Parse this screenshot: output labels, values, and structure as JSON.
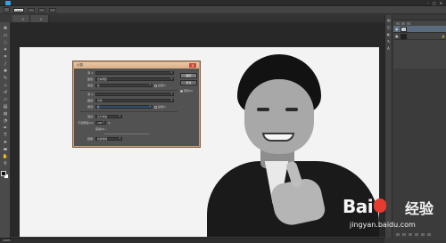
{
  "menubar": {
    "items": [
      "",
      "",
      "",
      "",
      "",
      "",
      "",
      "",
      "",
      "",
      ""
    ],
    "window_controls": [
      "-",
      "□",
      "✕"
    ]
  },
  "options": {
    "tool_label": "",
    "zoom_value": "100%",
    "button_1": "",
    "button_2": "",
    "button_3": ""
  },
  "tabs": [
    {
      "label": "",
      "close": "×"
    },
    {
      "label": "",
      "close": "×"
    }
  ],
  "dialog": {
    "title": "计算",
    "close": "×",
    "source1_label": "源 1:",
    "source1_file": "",
    "layer1_label": "图层:",
    "layer1_value": "合并图层",
    "channel1_label": "通道:",
    "channel1_value": "红",
    "invert_label": "反相(I)",
    "source2_label": "源 2:",
    "source2_file": "",
    "layer2_label": "图层:",
    "layer2_value": "背景",
    "channel2_label": "通道:",
    "channel2_value": "红",
    "blend_label": "混合:",
    "blend_value": "正片叠底",
    "opacity_label": "不透明度(O):",
    "opacity_value": "100",
    "opacity_unit": "%",
    "mask_label": "蒙版(K)...",
    "result_label": "结果:",
    "result_value": "新建通道",
    "ok": "确定",
    "reset": "复位",
    "preview": "预览(P)"
  },
  "layers": {
    "header": "",
    "rows": [
      {
        "name": "",
        "selected": true,
        "dark": false
      },
      {
        "name": "",
        "selected": false,
        "dark": true
      }
    ]
  },
  "status": {
    "zoom": "100%"
  },
  "watermark": {
    "bai": "Bai",
    "jingyan": "经验",
    "url": "jingyan.baidu.com"
  }
}
